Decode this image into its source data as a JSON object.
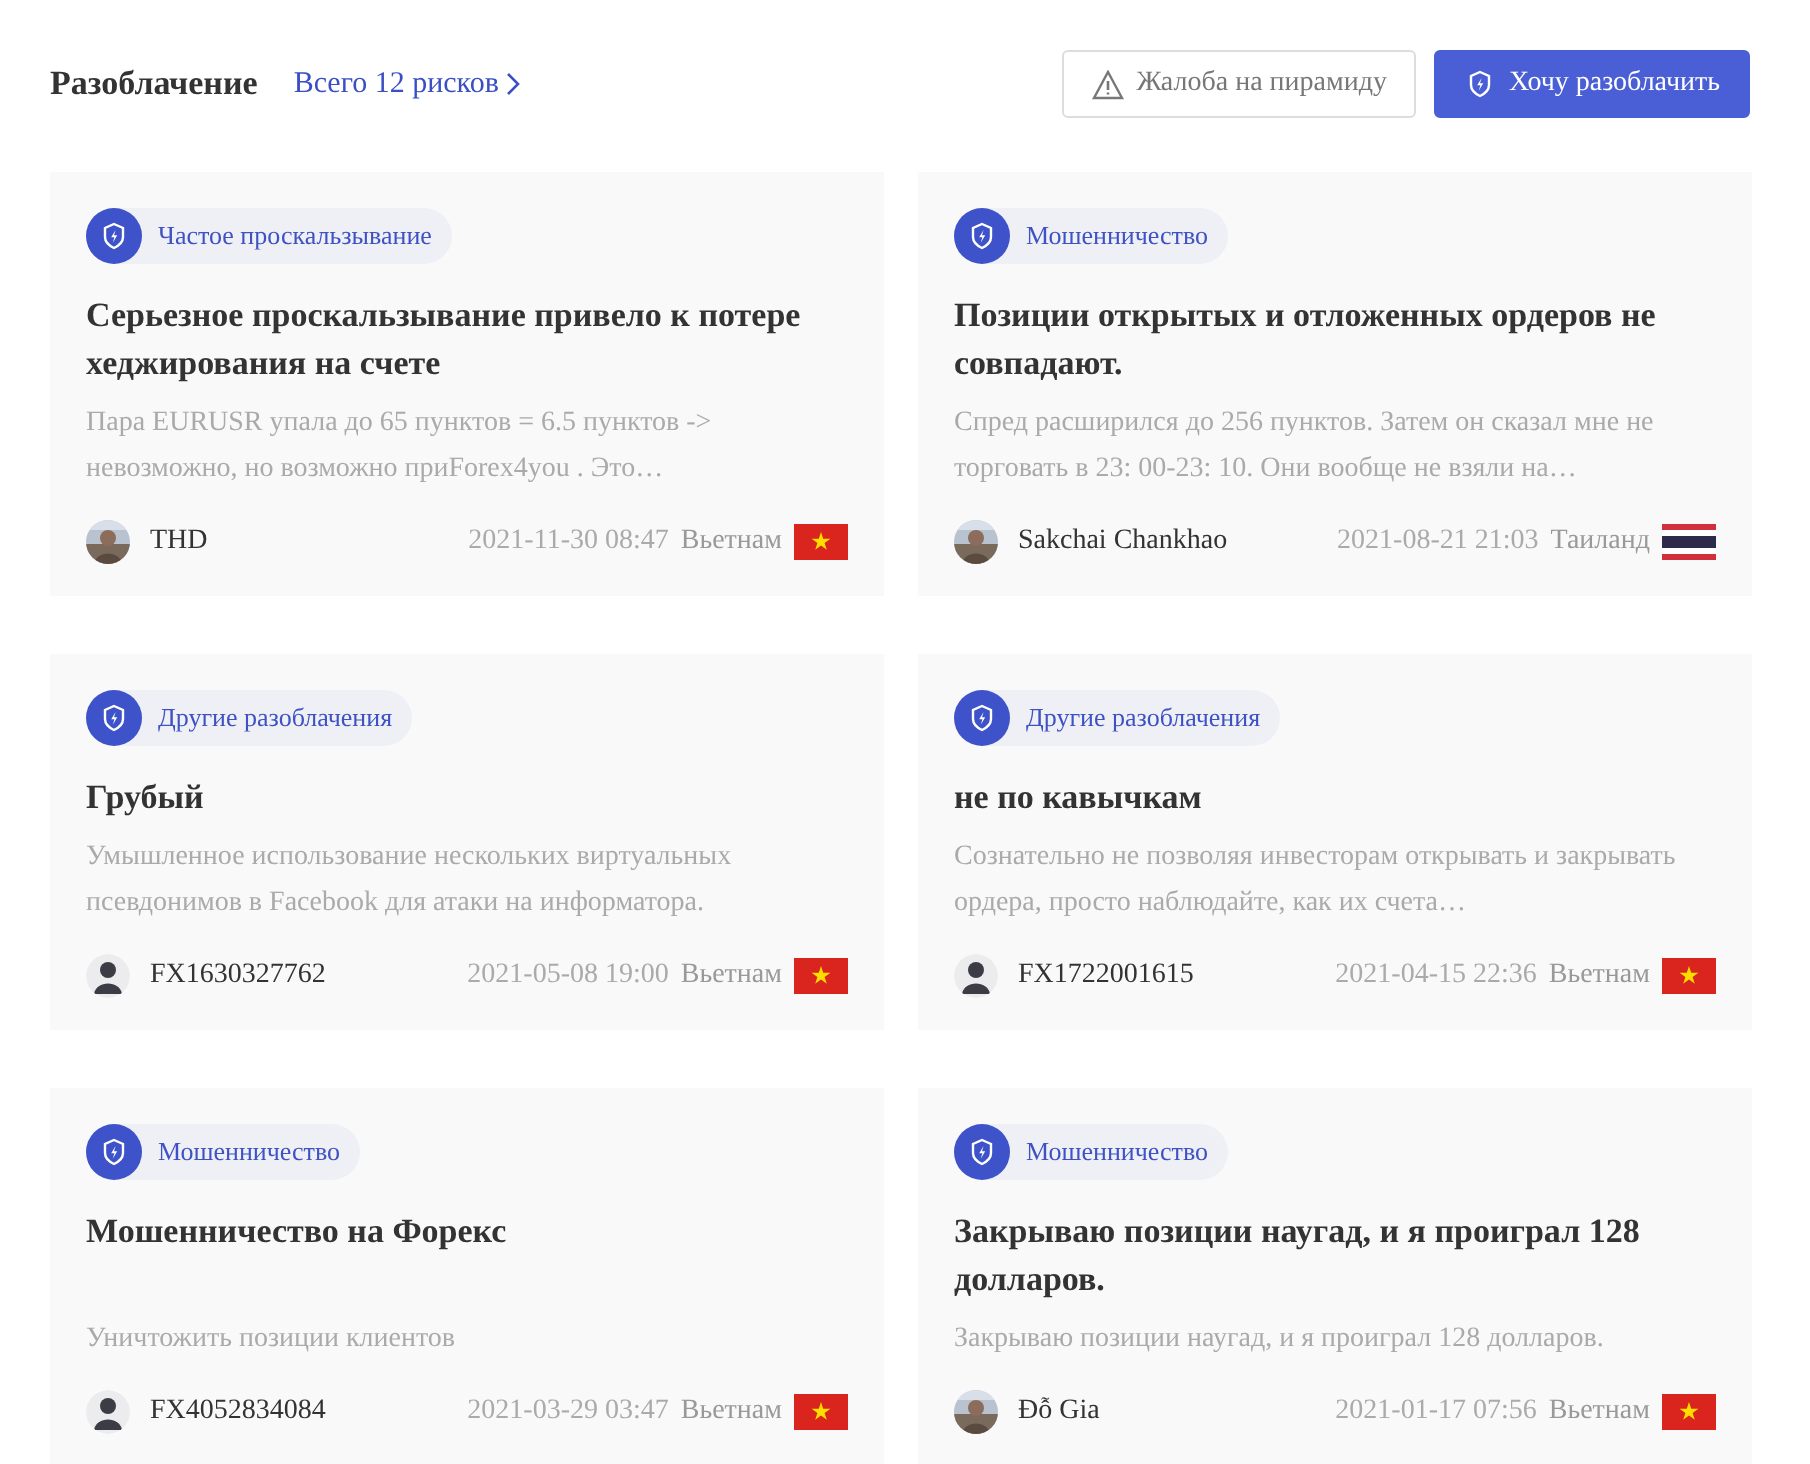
{
  "header": {
    "title": "Разоблачение",
    "total_link": "Всего 12 рисков",
    "buttons": [
      {
        "kind": "outline",
        "label": "Жалоба на пирамиду"
      },
      {
        "kind": "primary",
        "label": "Хочу разоблачить"
      }
    ]
  },
  "cards": [
    {
      "tag": "Частое проскальзывание",
      "title": "Серьезное проскальзывание привело к потере хеджирования на счете",
      "description": "Пара EURUSR упала до 65 пунктов = 6.5 пунктов -> невозможно, но возможно приForex4you . Это…",
      "author": "THD",
      "date": "2021-11-30 08:47",
      "country": "Вьетнам",
      "flag": {
        "kind": "vietnam"
      }
    },
    {
      "tag": "Мошенничество",
      "title": "Позиции открытых и отложенных ордеров не совпадают.",
      "description": "Спред расширился до 256 пунктов. Затем он сказал мне не торговать в 23: 00-23: 10. Они вообще не взяли на…",
      "author": "Sakchai Chankhao",
      "date": "2021-08-21 21:03",
      "country": "Таиланд",
      "flag": {
        "kind": "thailand"
      }
    },
    {
      "tag": "Другие разоблачения",
      "title": "Грубый",
      "description": "Умышленное использование нескольких виртуальных псевдонимов в Facebook для атаки на информатора.",
      "avatar": {
        "kind": "default"
      },
      "author": "FX1630327762",
      "date": "2021-05-08 19:00",
      "country": "Вьетнам",
      "flag": {
        "kind": "vietnam"
      }
    },
    {
      "tag": "Другие разоблачения",
      "title": "не по кавычкам",
      "description": "Сознательно не позволяя инвесторам открывать и закрывать ордера, просто наблюдайте, как их счета…",
      "avatar": {
        "kind": "default"
      },
      "author": "FX1722001615",
      "date": "2021-04-15 22:36",
      "country": "Вьетнам",
      "flag": {
        "kind": "vietnam"
      }
    },
    {
      "tag": "Мошенничество",
      "title": "Мошенничество на Форекс",
      "description": "Уничтожить позиции клиентов",
      "avatar": {
        "kind": "default"
      },
      "author": "FX4052834084",
      "date": "2021-03-29 03:47",
      "country": "Вьетнам",
      "flag": {
        "kind": "vietnam"
      }
    },
    {
      "tag": "Мошенничество",
      "title": "Закрываю позиции наугад, и я проиграл 128 долларов.",
      "description": "Закрываю позиции наугад, и я проиграл 128 долларов.",
      "author": "Đỗ Gia",
      "date": "2021-01-17 07:56",
      "country": "Вьетнам",
      "flag": {
        "kind": "vietnam"
      }
    }
  ]
}
